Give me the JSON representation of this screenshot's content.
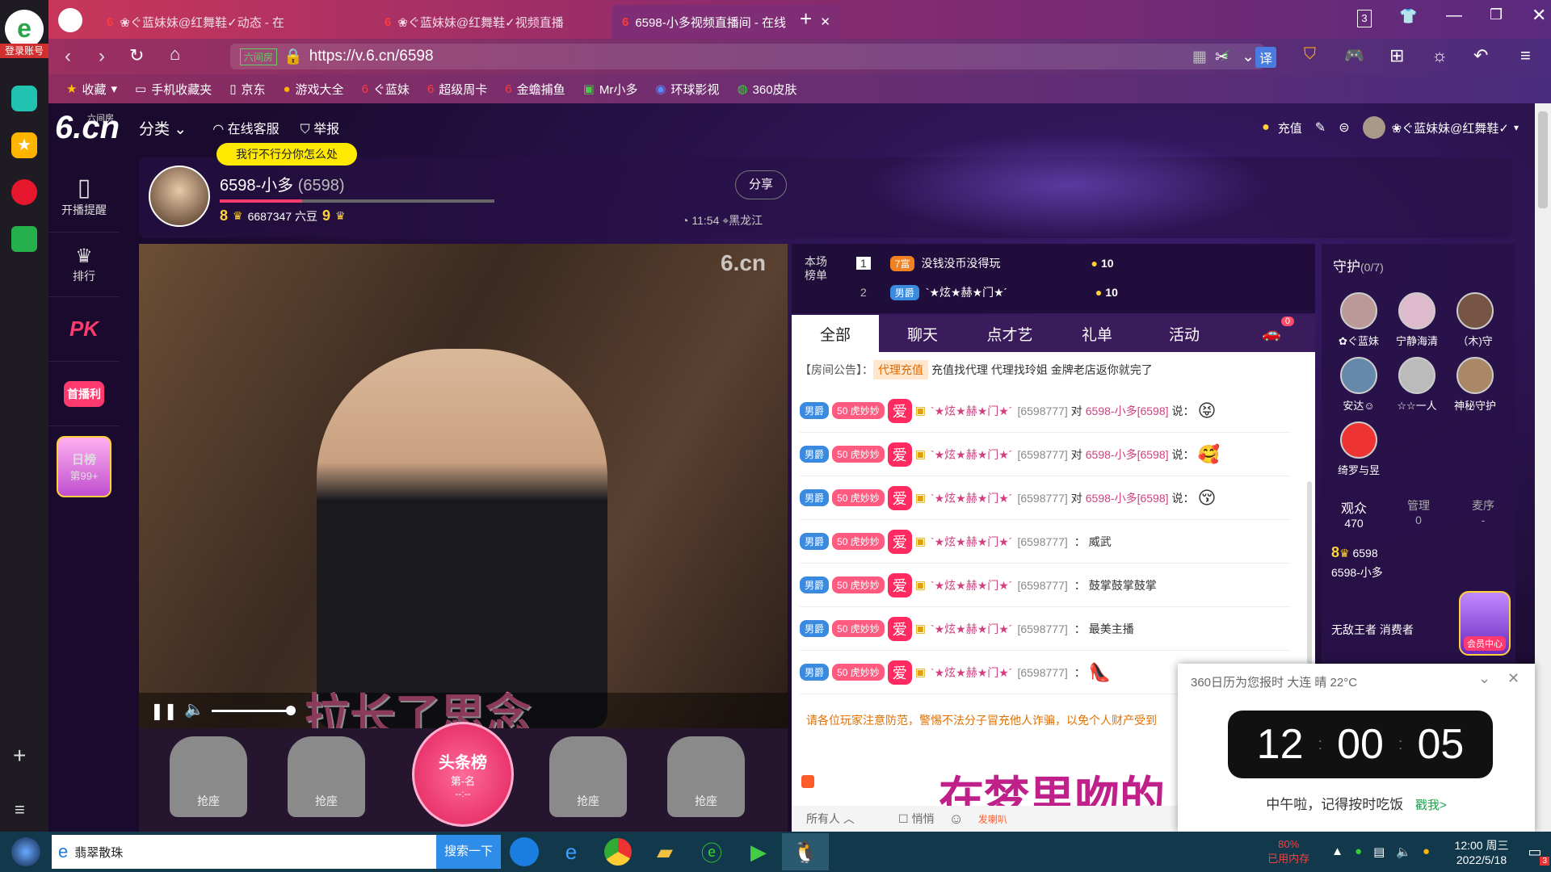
{
  "browser": {
    "login_label": "登录账号",
    "tabs": [
      "❀ぐ蓝妹妹@红舞鞋✓动态 - 在",
      "❀ぐ蓝妹妹@红舞鞋✓视频直播",
      "6598-小多视频直播间 - 在线"
    ],
    "tab_count": "3",
    "url": "https://v.6.cn/6598",
    "url_tag": "六间房",
    "bookmarks": [
      "收藏",
      "手机收藏夹",
      "京东",
      "游戏大全",
      "ぐ蓝妹",
      "超级周卡",
      "金蟾捕鱼",
      "Mr小多",
      "环球影视",
      "360皮肤"
    ],
    "translate_label": "译"
  },
  "site": {
    "logo": "6.cn",
    "logo_sub": "六间房",
    "nav": {
      "category": "分类",
      "service": "在线客服",
      "report": "举报"
    },
    "side": [
      {
        "label": "开播提醒"
      },
      {
        "label": "排行"
      },
      {
        "label": "PK"
      },
      {
        "label": "首播利"
      },
      {
        "label": "日榜",
        "sub": "第99+"
      }
    ],
    "user": {
      "recharge": "充值",
      "name": "❀ぐ蓝妹妹@红舞鞋✓"
    }
  },
  "host": {
    "slogan": "我行不行分你怎么处",
    "name": "6598-小多",
    "id": "(6598)",
    "level_left": "8",
    "beans": "6687347 六豆",
    "level_right": "9",
    "share": "分享",
    "time": "11:54",
    "location": "黑龙江"
  },
  "video": {
    "lyric": "拉长了思念",
    "watermark": "6.cn",
    "seat_label": "抢座",
    "headline_title": "头条榜",
    "headline_rank": "第-名",
    "headline_dash": "--:--"
  },
  "rank": {
    "label": "本场榜单",
    "rows": [
      {
        "rank": "1",
        "badge": "7富",
        "name": "没钱没币没得玩",
        "coins": "10"
      },
      {
        "rank": "2",
        "badge": "男爵",
        "name": "`★炫★赫★门★´",
        "coins": "10"
      }
    ]
  },
  "chat": {
    "tabs": [
      "全部",
      "聊天",
      "点才艺",
      "礼单",
      "活动"
    ],
    "car_count": "0",
    "notice_label": "【房间公告】：",
    "notice_tag": "代理充值",
    "notice_text": "充值找代理 代理找玲姐 金牌老店返你就完了",
    "messages": [
      {
        "title": "男爵",
        "fan": "50 虎妙妙",
        "love": "爱",
        "user": "`★炫★赫★门★´",
        "uid": "[6598777]",
        "to": "对",
        "target": "6598-小多[6598]",
        "say": "说：",
        "text": "",
        "emoji": "😝"
      },
      {
        "title": "男爵",
        "fan": "50 虎妙妙",
        "love": "爱",
        "user": "`★炫★赫★门★´",
        "uid": "[6598777]",
        "to": "对",
        "target": "6598-小多[6598]",
        "say": "说：",
        "text": "",
        "emoji": "🥰"
      },
      {
        "title": "男爵",
        "fan": "50 虎妙妙",
        "love": "爱",
        "user": "`★炫★赫★门★´",
        "uid": "[6598777]",
        "to": "对",
        "target": "6598-小多[6598]",
        "say": "说：",
        "text": "",
        "emoji": "😚"
      },
      {
        "title": "男爵",
        "fan": "50 虎妙妙",
        "love": "爱",
        "user": "`★炫★赫★门★´",
        "uid": "[6598777]",
        "to": "",
        "target": "",
        "say": "：",
        "text": "威武",
        "emoji": ""
      },
      {
        "title": "男爵",
        "fan": "50 虎妙妙",
        "love": "爱",
        "user": "`★炫★赫★门★´",
        "uid": "[6598777]",
        "to": "",
        "target": "",
        "say": "：",
        "text": "鼓掌鼓掌鼓掌",
        "emoji": ""
      },
      {
        "title": "男爵",
        "fan": "50 虎妙妙",
        "love": "爱",
        "user": "`★炫★赫★门★´",
        "uid": "[6598777]",
        "to": "",
        "target": "",
        "say": "：",
        "text": "最美主播",
        "emoji": ""
      },
      {
        "title": "男爵",
        "fan": "50 虎妙妙",
        "love": "爱",
        "user": "`★炫★赫★门★´",
        "uid": "[6598777]",
        "to": "",
        "target": "",
        "say": "：",
        "text": "",
        "emoji": "👠"
      }
    ],
    "warning": "请各位玩家注意防范，警惕不法分子冒充他人诈骗，以免个人财产受到",
    "scroll_text": "在梦里吻的",
    "recipient": "所有人",
    "whisper": "悄悄",
    "broadcast_label": "发喇叭"
  },
  "guard": {
    "title": "守护",
    "count": "(0/7)",
    "members": [
      "✿ぐ蓝妹",
      "宁静海清",
      "（木)守",
      "安达☺",
      "☆☆一人",
      "神秘守护",
      "绮罗与昱"
    ],
    "stats": [
      {
        "label": "观众",
        "value": "470"
      },
      {
        "label": "管理",
        "value": "0"
      },
      {
        "label": "麦序",
        "value": "-"
      }
    ],
    "host_level": "8",
    "host_id": "6598",
    "host_name": "6598-小多",
    "tag1": "无敌王者",
    "tag2": "消费者",
    "vip_label": "会员中心"
  },
  "clock": {
    "header": "360日历为您报时 大连 晴 22°C",
    "hours": "12",
    "minutes": "00",
    "seconds": "05",
    "message": "中午啦，记得按时吃饭",
    "link": "戳我>"
  },
  "taskbar": {
    "search_text": "翡翠散珠",
    "search_button": "搜索一下",
    "mem_pct": "80%",
    "mem_label": "已用内存",
    "time": "12:00 周三",
    "date": "2022/5/18",
    "notif": "3"
  },
  "colors": {
    "accent": "#ff3a6e",
    "gold": "#ffd23c",
    "purple": "#3a1c5c"
  }
}
